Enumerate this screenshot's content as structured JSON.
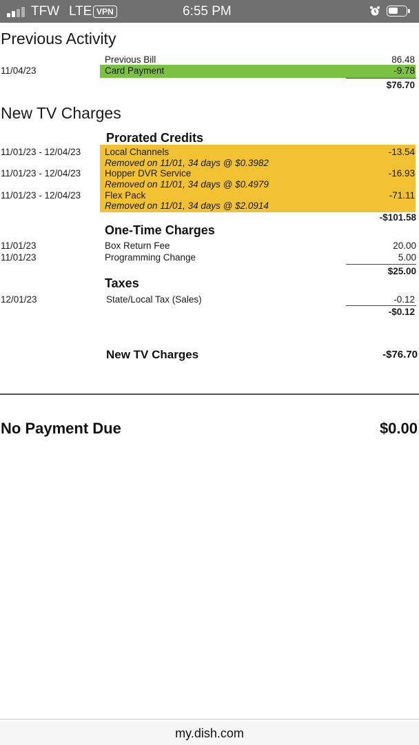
{
  "status_bar": {
    "carrier": "TFW",
    "network": "LTE",
    "vpn": "VPN",
    "time": "6:55 PM",
    "signal_bars": 2,
    "icons": [
      "signal-icon",
      "alarm-icon",
      "battery-icon"
    ]
  },
  "previous_activity": {
    "title": "Previous Activity",
    "previous_bill_label": "Previous Bill",
    "previous_bill_amount": "86.48",
    "payment_date": "11/04/23",
    "payment_label": "Card Payment",
    "payment_amount": "-9.78",
    "total": "$76.70"
  },
  "new_tv_charges": {
    "title": "New TV Charges",
    "prorated": {
      "heading": "Prorated Credits",
      "items": [
        {
          "date": "11/01/23 - 12/04/23",
          "label": "Local Channels",
          "amount": "-13.54",
          "note": "Removed on 11/01, 34 days @ $0.3982"
        },
        {
          "date": "11/01/23 - 12/04/23",
          "label": "Hopper DVR Service",
          "amount": "-16.93",
          "note": "Removed on 11/01, 34 days @ $0.4979"
        },
        {
          "date": "11/01/23 - 12/04/23",
          "label": "Flex Pack",
          "amount": "-71.11",
          "note": "Removed on 11/01, 34 days @ $2.0914"
        }
      ],
      "total": "-$101.58"
    },
    "one_time": {
      "heading": "One-Time Charges",
      "items": [
        {
          "date": "11/01/23",
          "label": "Box Return Fee",
          "amount": "20.00"
        },
        {
          "date": "11/01/23",
          "label": "Programming Change",
          "amount": "5.00"
        }
      ],
      "total": "$25.00"
    },
    "taxes": {
      "heading": "Taxes",
      "items": [
        {
          "date": "12/01/23",
          "label": "State/Local Tax (Sales)",
          "amount": "-0.12"
        }
      ],
      "total": "-$0.12"
    },
    "summary_label": "New TV Charges",
    "summary_amount": "-$76.70"
  },
  "payment_due": {
    "label": "No Payment Due",
    "amount": "$0.00"
  },
  "footer": {
    "url": "my.dish.com"
  },
  "colors": {
    "status_bar": "#6f6f6f",
    "highlight_green": "#7bc142",
    "highlight_yellow": "#f2c233"
  }
}
